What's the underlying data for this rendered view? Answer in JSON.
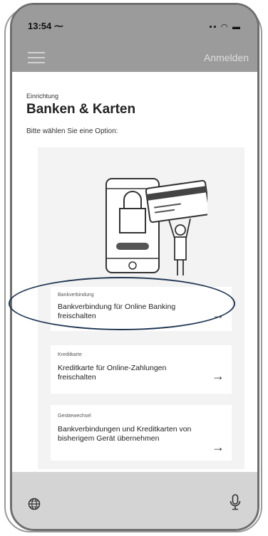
{
  "status": {
    "time": "13:54 ⁓",
    "icons": "▪▪ ◠ ▬"
  },
  "header": {
    "login_label": "Anmelden",
    "menu_icon": "hamburger-icon"
  },
  "page": {
    "eyebrow": "Einrichtung",
    "title": "Banken & Karten",
    "subtitle": "Bitte wählen Sie eine Option:"
  },
  "options": [
    {
      "label": "Bankverbindung",
      "title": "Bankverbindung für Online Banking freischalten",
      "arrow": "→"
    },
    {
      "label": "Kreditkarte",
      "title": "Kreditkarte für Online-Zahlungen freischalten",
      "arrow": "→"
    },
    {
      "label": "Gerätewechsel",
      "title": "Bankverbindungen und Kreditkarten von bisherigem Gerät übernehmen",
      "arrow": "→"
    }
  ],
  "bottom": {
    "left_icon": "globe-icon",
    "right_icon": "microphone-icon"
  },
  "colors": {
    "header": "#9b9b9b",
    "highlight": "#1f3552"
  }
}
